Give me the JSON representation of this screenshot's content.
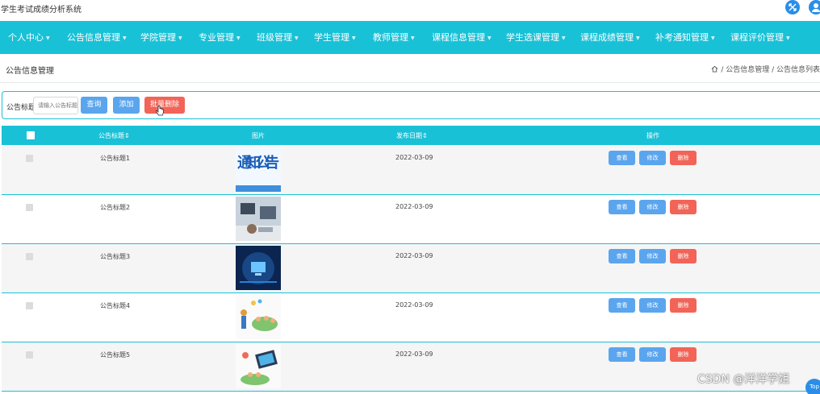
{
  "app": {
    "title": "学生考试成绩分析系统"
  },
  "nav": {
    "items": [
      {
        "label": "个人中心"
      },
      {
        "label": "公告信息管理"
      },
      {
        "label": "学院管理"
      },
      {
        "label": "专业管理"
      },
      {
        "label": "班级管理"
      },
      {
        "label": "学生管理"
      },
      {
        "label": "教师管理"
      },
      {
        "label": "课程信息管理"
      },
      {
        "label": "学生选课管理"
      },
      {
        "label": "课程成绩管理"
      },
      {
        "label": "补考通知管理"
      },
      {
        "label": "课程评价管理"
      }
    ]
  },
  "breadcrumb": {
    "page_title": "公告信息管理",
    "path": "/ 公告信息管理 / 公告信息列表"
  },
  "search": {
    "label": "公告标题",
    "placeholder": "请输入公告标题",
    "query_label": "查询",
    "add_label": "添加",
    "batch_delete_label": "批量删除"
  },
  "table": {
    "columns": [
      "公告标题",
      "图片",
      "发布日期",
      "操作"
    ],
    "rows": [
      {
        "title": "公告标题1",
        "date": "2022-03-09",
        "image": "notice-banner"
      },
      {
        "title": "公告标题2",
        "date": "2022-03-09",
        "image": "office-desk"
      },
      {
        "title": "公告标题3",
        "date": "2022-03-09",
        "image": "tech-screen"
      },
      {
        "title": "公告标题4",
        "date": "2022-03-09",
        "image": "classroom-illustration"
      },
      {
        "title": "公告标题5",
        "date": "2022-03-09",
        "image": "online-class-illustration"
      }
    ],
    "actions": {
      "view": "查看",
      "edit": "修改",
      "delete": "删除"
    }
  },
  "notice_image_text": "通知公告",
  "watermark": "CSDN @洋洋学姐",
  "top_button": "Top",
  "colors": {
    "primary": "#19c1d7",
    "button_blue": "#5aa5ee",
    "button_red": "#f26457"
  }
}
